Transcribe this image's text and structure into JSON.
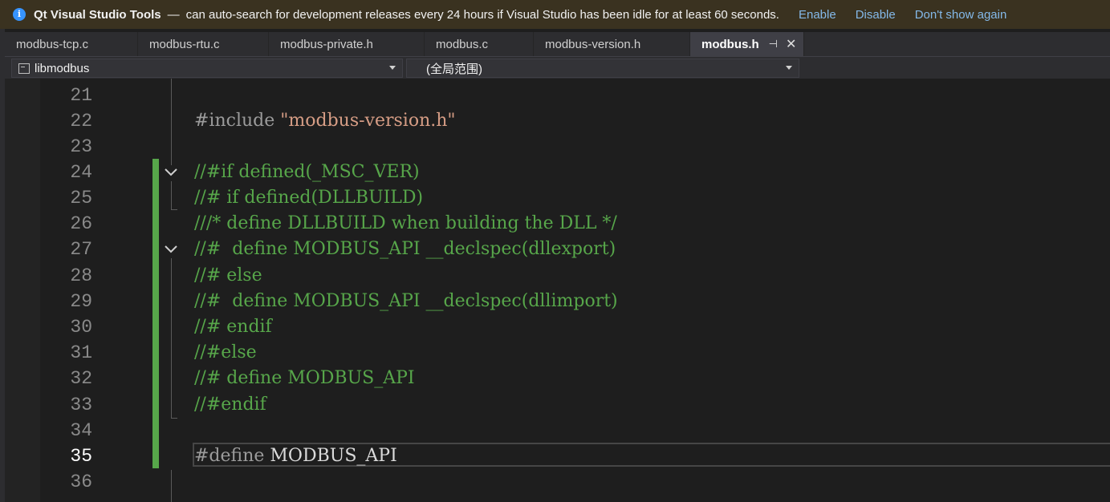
{
  "infobar": {
    "title": "Qt Visual Studio Tools",
    "dash": "—",
    "message": "can auto-search for development releases every 24 hours if Visual Studio has been idle for at least 60 seconds.",
    "enable": "Enable",
    "disable": "Disable",
    "dont_show": "Don't show again",
    "icon": "info-icon"
  },
  "tabs": [
    {
      "label": "modbus-tcp.c"
    },
    {
      "label": "modbus-rtu.c"
    },
    {
      "label": "modbus-private.h"
    },
    {
      "label": "modbus.c"
    },
    {
      "label": "modbus-version.h"
    },
    {
      "label": "modbus.h",
      "active": true
    }
  ],
  "navbar": {
    "project": "libmodbus",
    "scope": "(全局范围)"
  },
  "editor": {
    "current_line": 35,
    "lines": [
      {
        "num": "21",
        "text": ""
      },
      {
        "num": "22",
        "pre": "#include ",
        "str": "\"modbus-version.h\""
      },
      {
        "num": "23",
        "text": ""
      },
      {
        "num": "24",
        "cmt": "//#if defined(_MSC_VER)"
      },
      {
        "num": "25",
        "cmt": "//# if defined(DLLBUILD)"
      },
      {
        "num": "26",
        "cmt": "///* define DLLBUILD when building the DLL */"
      },
      {
        "num": "27",
        "cmt": "//#  define MODBUS_API __declspec(dllexport)"
      },
      {
        "num": "28",
        "cmt": "//# else"
      },
      {
        "num": "29",
        "cmt": "//#  define MODBUS_API __declspec(dllimport)"
      },
      {
        "num": "30",
        "cmt": "//# endif"
      },
      {
        "num": "31",
        "cmt": "//#else"
      },
      {
        "num": "32",
        "cmt": "//# define MODBUS_API"
      },
      {
        "num": "33",
        "cmt": "//#endif"
      },
      {
        "num": "34",
        "text": ""
      },
      {
        "num": "35",
        "pre": "#define ",
        "def": "MODBUS_API"
      },
      {
        "num": "36",
        "text": ""
      }
    ]
  },
  "colors": {
    "comment": "#57a64a",
    "string": "#d69d85",
    "preprocessor": "#9b9b9b",
    "link": "#84b9e9",
    "infobar_bg": "#3a3220"
  }
}
